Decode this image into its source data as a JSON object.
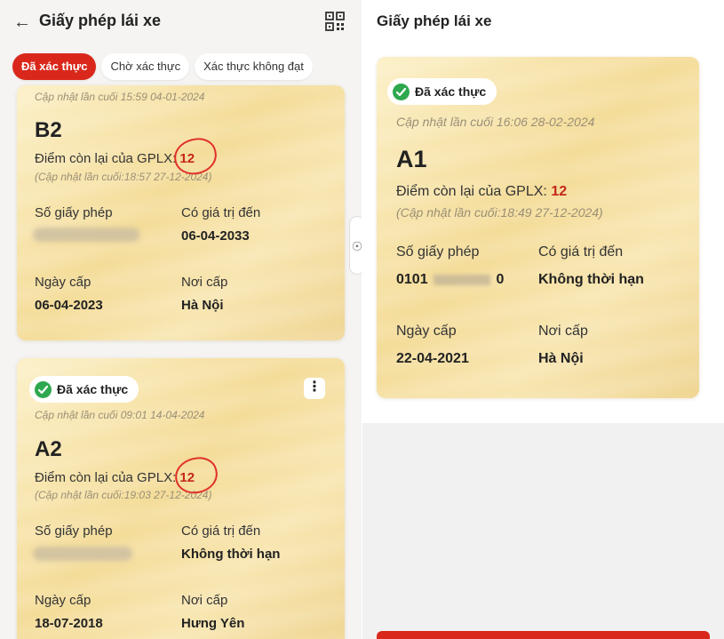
{
  "left": {
    "header": {
      "title": "Giấy phép lái xe"
    },
    "tabs": [
      {
        "label": "Đã xác thực"
      },
      {
        "label": "Chờ xác thực"
      },
      {
        "label": "Xác thực không đạt"
      }
    ],
    "cards": [
      {
        "updated": "Cập nhật lần cuối 15:59 04-01-2024",
        "license_class": "B2",
        "points_label": "Điểm còn lại của GPLX:",
        "points": "12",
        "points_updated": "(Cập nhật lần cuối:18:57 27-12-2024)",
        "license_no_label": "Số giấy phép",
        "valid_until_label": "Có giá trị đến",
        "valid_until": "06-04-2033",
        "issue_date_label": "Ngày cấp",
        "issue_date": "06-04-2023",
        "issue_place_label": "Nơi cấp",
        "issue_place": "Hà Nội"
      },
      {
        "badge": "Đã xác thực",
        "updated": "Cập nhật lần cuối 09:01 14-04-2024",
        "license_class": "A2",
        "points_label": "Điểm còn lại của GPLX:",
        "points": "12",
        "points_updated": "(Cập nhật lần cuối:19:03 27-12-2024)",
        "license_no_label": "Số giấy phép",
        "valid_until_label": "Có giá trị đến",
        "valid_until": "Không thời hạn",
        "issue_date_label": "Ngày cấp",
        "issue_date": "18-07-2018",
        "issue_place_label": "Nơi cấp",
        "issue_place": "Hưng Yên"
      }
    ]
  },
  "right": {
    "header": {
      "title": "Giấy phép lái xe"
    },
    "card": {
      "badge": "Đã xác thực",
      "updated": "Cập nhật lần cuối 16:06 28-02-2024",
      "license_class": "A1",
      "points_label": "Điểm còn lại của GPLX:",
      "points": "12",
      "points_updated": "(Cập nhật lần cuối:18:49 27-12-2024)",
      "license_no_label": "Số giấy phép",
      "license_no_prefix": "0101",
      "license_no_suffix": "0",
      "valid_until_label": "Có giá trị đến",
      "valid_until": "Không thời hạn",
      "issue_date_label": "Ngày cấp",
      "issue_date": "22-04-2021",
      "issue_place_label": "Nơi cấp",
      "issue_place": "Hà Nội"
    }
  },
  "colors": {
    "brand_red": "#d9281b",
    "verified_green": "#2ea84f",
    "card_gold": "#f4dc98"
  },
  "icons": {
    "back": "arrow-left-icon",
    "qr": "qr-scan-icon",
    "check": "check-circle-icon",
    "menu": "more-vertical-icon",
    "accessibility": "accessibility-icon"
  }
}
